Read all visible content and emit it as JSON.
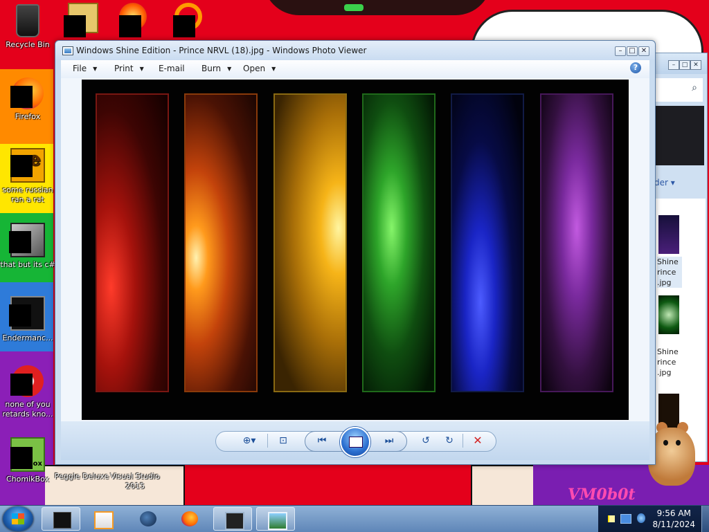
{
  "desktop": {
    "icons": [
      {
        "label": "Recycle Bin"
      },
      {
        "label": "Firefox"
      },
      {
        "label": "some russian ran a rat"
      },
      {
        "label": "that but its c#"
      },
      {
        "label": "Endermanc..."
      },
      {
        "label": "none of you retards kno..."
      },
      {
        "label": "ChomikBox"
      },
      {
        "label": "Peggle Deluxe"
      },
      {
        "label": "Visual Studio 2015"
      }
    ]
  },
  "window": {
    "title": "Windows Shine Edition - Prince NRVL (18).jpg - Windows Photo Viewer",
    "caption_buttons": {
      "minimize": "–",
      "maximize": "□",
      "close": "✕"
    },
    "menu": {
      "file": "File",
      "print": "Print",
      "email": "E-mail",
      "burn": "Burn",
      "open": "Open",
      "dropdown_arrow": "▼",
      "help": "?"
    },
    "toolbar": {
      "zoom": "⊕▾",
      "actual_size": "⊡",
      "previous": "⏮",
      "next": "⏭",
      "rotate_ccw": "↺",
      "rotate_cw": "↻",
      "delete": "✕"
    }
  },
  "background_window": {
    "folder_label": "der ▾",
    "items": [
      {
        "label": "Shine\nrince\n.jpg"
      },
      {
        "label": "Shine\nrince\n.jpg"
      }
    ]
  },
  "taskbar": {
    "time": "9:56 AM",
    "date": "8/11/2024"
  },
  "colors": {
    "wallpaper_red": "#e4001b",
    "window_frame": "#c9dcf0",
    "taskbar": "#5f86b8",
    "tray": "#0a1a36"
  }
}
